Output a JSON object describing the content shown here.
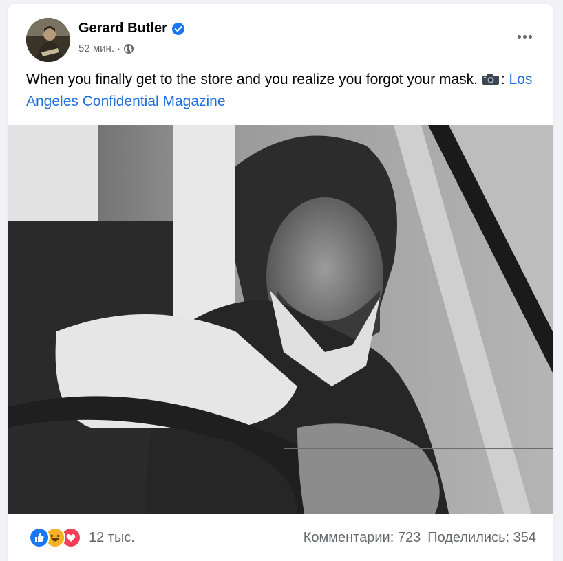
{
  "post": {
    "author": "Gerard Butler",
    "time": "52 мин.",
    "separator": "·",
    "text": "When you finally get to the store and you realize you forgot your mask.",
    "camera_suffix": ":",
    "link_text": "Los Angeles Confidential Magazine"
  },
  "footer": {
    "reactions_count": "12 тыс.",
    "comments_label": "Комментарии:",
    "comments_count": "723",
    "shares_label": "Поделились:",
    "shares_count": "354"
  },
  "icons": {
    "verified": "verified-badge-icon",
    "privacy": "globe-icon",
    "more": "more-options-icon",
    "camera": "camera-icon",
    "reactions": [
      "like-reaction-icon",
      "haha-reaction-icon",
      "love-reaction-icon"
    ]
  },
  "colors": {
    "accent": "#1877f2",
    "link": "#216fdb",
    "secondary_text": "#65676b",
    "love": "#f33e58",
    "haha": "#f7b125"
  }
}
